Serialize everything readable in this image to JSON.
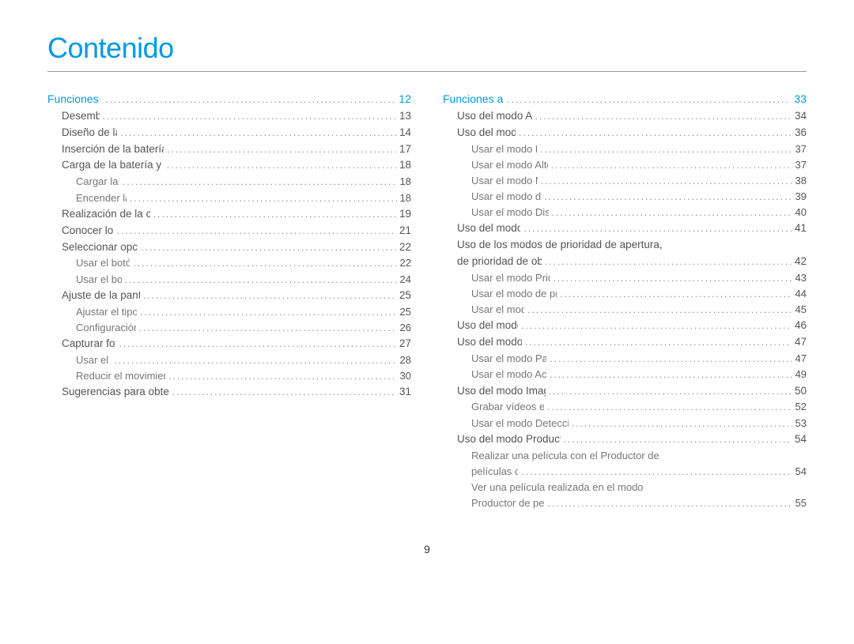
{
  "title": "Contenido",
  "page_number": "9",
  "left_column": [
    {
      "level": "section",
      "label": "Funciones básicas",
      "page": "12"
    },
    {
      "level": "sub",
      "label": "Desembalaje",
      "page": "13"
    },
    {
      "level": "sub",
      "label": "Diseño de la cámara",
      "page": "14"
    },
    {
      "level": "sub",
      "label": "Inserción de la batería y la tarjeta de memoria",
      "page": "17"
    },
    {
      "level": "sub",
      "label": "Carga de la batería y encendido de la cámara",
      "page": "18"
    },
    {
      "level": "subsub",
      "label": "Cargar la batería",
      "page": "18"
    },
    {
      "level": "subsub",
      "label": "Encender la cámara",
      "page": "18"
    },
    {
      "level": "sub",
      "label": "Realización de la configuración inicial",
      "page": "19"
    },
    {
      "level": "sub",
      "label": "Conocer los iconos",
      "page": "21"
    },
    {
      "level": "sub",
      "label": "Seleccionar opciones o menús",
      "page": "22"
    },
    {
      "level": "subsub",
      "label": "Usar el botón [MENU]",
      "page": "22"
    },
    {
      "level": "subsub",
      "label": "Usar el botón [Fn]",
      "page": "24"
    },
    {
      "level": "sub",
      "label": "Ajuste de la pantalla y el sonido",
      "page": "25"
    },
    {
      "level": "subsub",
      "label": "Ajustar el tipo de pantalla",
      "page": "25"
    },
    {
      "level": "subsub",
      "label": "Configuración del sonido",
      "page": "26"
    },
    {
      "level": "sub",
      "label": "Capturar fotografías",
      "page": "27"
    },
    {
      "level": "subsub",
      "label": "Usar el zoom",
      "page": "28"
    },
    {
      "level": "subsub",
      "label": "Reducir el movimiento de la cámara (OIS)",
      "page": "30"
    },
    {
      "level": "sub",
      "label": "Sugerencias para obtener fotografías más nítidas",
      "page": "31"
    }
  ],
  "right_column": [
    {
      "level": "section",
      "label": "Funciones ampliadas",
      "page": "33"
    },
    {
      "level": "sub",
      "label": "Uso del modo Auto inteligente",
      "page": "34"
    },
    {
      "level": "sub",
      "label": "Uso del modo Escena",
      "page": "36"
    },
    {
      "level": "subsub",
      "label": "Usar el modo Fotografía 3D",
      "page": "37"
    },
    {
      "level": "subsub",
      "label": "Usar el modo Alto rango dinámico",
      "page": "37"
    },
    {
      "level": "subsub",
      "label": "Usar el modo Marco Mágico",
      "page": "38"
    },
    {
      "level": "subsub",
      "label": "Usar el modo de disparo bello",
      "page": "39"
    },
    {
      "level": "subsub",
      "label": "Usar el modo Disparo de aumento",
      "page": "40"
    },
    {
      "level": "sub",
      "label": "Uso del modo Programa",
      "page": "41"
    },
    {
      "level": "sub",
      "label": "Uso de los modos de prioridad de apertura,",
      "nopage": true
    },
    {
      "level": "sub",
      "label": "de prioridad de obturador o manual",
      "page": "42"
    },
    {
      "level": "subsub",
      "label": "Usar el modo Prioridad de apertura",
      "page": "43"
    },
    {
      "level": "subsub",
      "label": "Usar el modo de prioridad de obturador",
      "page": "44"
    },
    {
      "level": "subsub",
      "label": "Usar el modo manual",
      "page": "45"
    },
    {
      "level": "sub",
      "label": "Uso del modo DUAL IS",
      "page": "46"
    },
    {
      "level": "sub",
      "label": "Uso del modo Panorama",
      "page": "47"
    },
    {
      "level": "subsub",
      "label": "Usar el modo Panorama 2D o 3D",
      "page": "47"
    },
    {
      "level": "subsub",
      "label": "Usar el modo Acción panorámica",
      "page": "49"
    },
    {
      "level": "sub",
      "label": "Uso del modo Imagen en movimiento",
      "page": "50"
    },
    {
      "level": "subsub",
      "label": "Grabar vídeos en alta velocidad",
      "page": "52"
    },
    {
      "level": "subsub",
      "label": "Usar el modo Detección inteligente de escenas",
      "page": "53"
    },
    {
      "level": "sub",
      "label": "Uso del modo Productor de películas creativas",
      "page": "54"
    },
    {
      "level": "subsub",
      "label": "Realizar una película con el Productor de",
      "nopage": true
    },
    {
      "level": "subsub",
      "label": "películas creativas",
      "page": "54"
    },
    {
      "level": "subsub",
      "label": "Ver una película realizada en el modo",
      "nopage": true
    },
    {
      "level": "subsub",
      "label": "Productor de películas creativas",
      "page": "55"
    }
  ]
}
